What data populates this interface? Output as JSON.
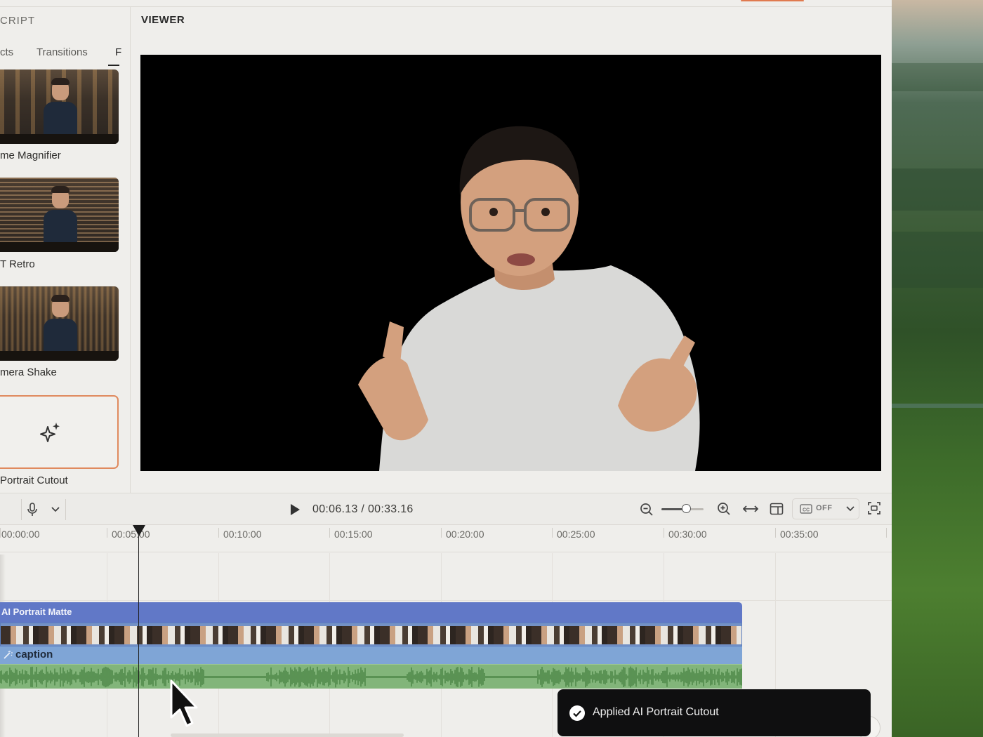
{
  "left_panel": {
    "title": "CRIPT",
    "tabs": [
      "cts",
      "Transitions",
      "F"
    ],
    "effects": [
      {
        "label": "me Magnifier"
      },
      {
        "label": "T Retro"
      },
      {
        "label": "mera Shake"
      },
      {
        "label": "Portrait Cutout"
      }
    ]
  },
  "viewer": {
    "title": "VIEWER"
  },
  "playback": {
    "current_time": "00:06.13",
    "separator": " / ",
    "total_time": "00:33.16",
    "cc_state": "OFF"
  },
  "ruler": {
    "ticks": [
      "00:00:00",
      "00:05:00",
      "00:10:00",
      "00:15:00",
      "00:20:00",
      "00:25:00",
      "00:30:00",
      "00:35:00"
    ]
  },
  "tracks": {
    "matte_label": "AI Portrait Matte",
    "caption_label": "caption"
  },
  "toast": {
    "message": "Applied AI Portrait Cutout"
  },
  "colors": {
    "accent": "#e08a5e",
    "matte_track": "#6178c7",
    "caption_track": "#7fa5d6",
    "audio_track": "#82b57a"
  },
  "icons": [
    "microphone-icon",
    "chevron-down-icon",
    "play-icon",
    "zoom-out-icon",
    "zoom-in-icon",
    "fit-width-icon",
    "layout-icon",
    "closed-caption-icon",
    "fullscreen-icon",
    "sparkle-icon",
    "check-icon",
    "magic-wand-icon"
  ]
}
